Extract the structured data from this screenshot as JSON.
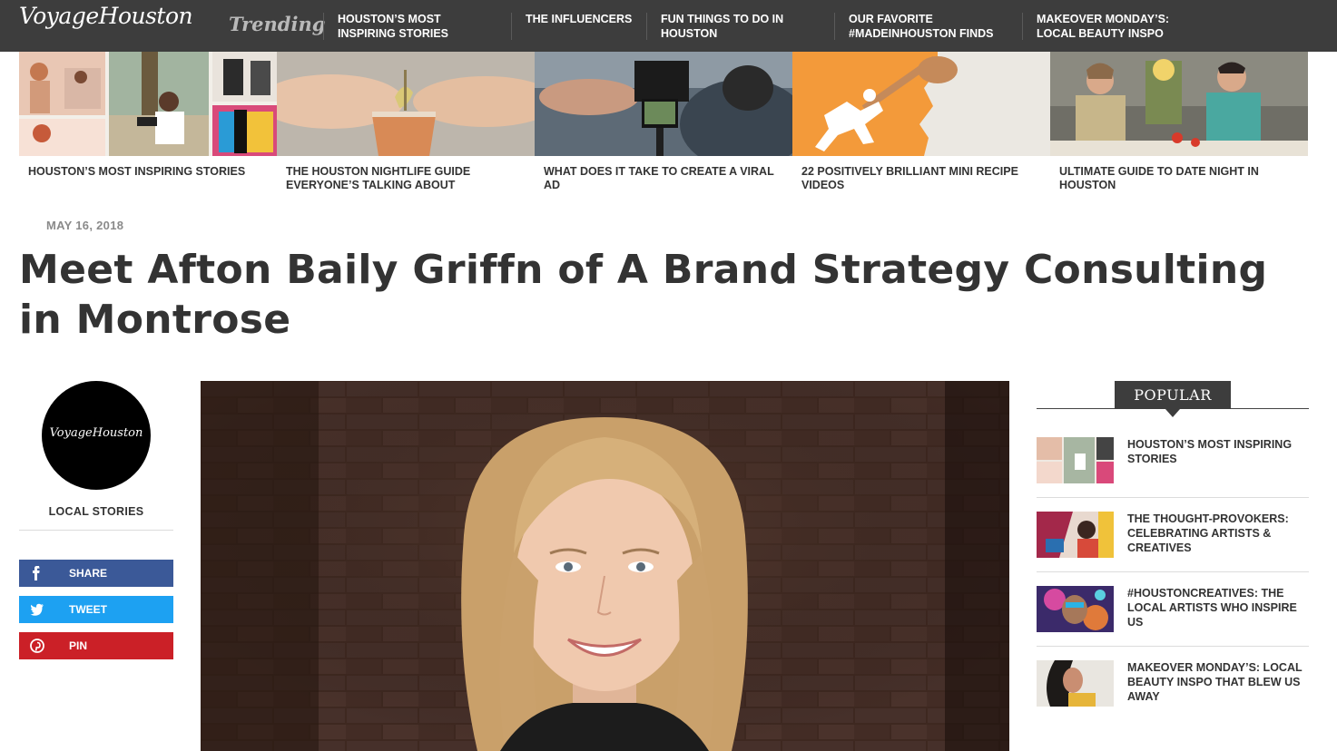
{
  "site": {
    "logo": "VoyageHouston"
  },
  "nav": {
    "trending_label": "Trending",
    "links": [
      "HOUSTON’S MOST INSPIRING STORIES",
      "THE INFLUENCERS",
      "FUN THINGS TO DO IN HOUSTON",
      "OUR FAVORITE #MADEINHOUSTON FINDS",
      "MAKEOVER MONDAY’S: LOCAL BEAUTY INSPO"
    ]
  },
  "strip": [
    {
      "caption": "HOUSTON’S MOST INSPIRING STORIES"
    },
    {
      "caption": "THE HOUSTON NIGHTLIFE GUIDE EVERYONE’S TALKING ABOUT"
    },
    {
      "caption": "WHAT DOES IT TAKE TO CREATE A VIRAL AD"
    },
    {
      "caption": "22 POSITIVELY BRILLIANT MINI RECIPE VIDEOS"
    },
    {
      "caption": "ULTIMATE GUIDE TO DATE NIGHT IN HOUSTON"
    }
  ],
  "article": {
    "date": "MAY 16, 2018",
    "title": "Meet Afton Baily Griffn of A Brand Strategy Consulting in Montrose"
  },
  "author_box": {
    "badge_text": "VoyageHouston",
    "label": "LOCAL STORIES"
  },
  "social": {
    "share": "SHARE",
    "tweet": "TWEET",
    "pin": "PIN"
  },
  "sidebar": {
    "heading": "POPULAR",
    "items": [
      {
        "title": "HOUSTON’S MOST INSPIRING STORIES"
      },
      {
        "title": "THE THOUGHT-PROVOKERS: CELEBRATING ARTISTS & CREATIVES"
      },
      {
        "title": "#HOUSTONCREATIVES: THE LOCAL ARTISTS WHO INSPIRE US"
      },
      {
        "title": "MAKEOVER MONDAY’S: LOCAL BEAUTY INSPO THAT BLEW US AWAY"
      }
    ]
  },
  "colors": {
    "nav_bg": "#3d3d3d",
    "facebook": "#3b5998",
    "twitter": "#1da1f2",
    "pinterest": "#cb2027"
  }
}
